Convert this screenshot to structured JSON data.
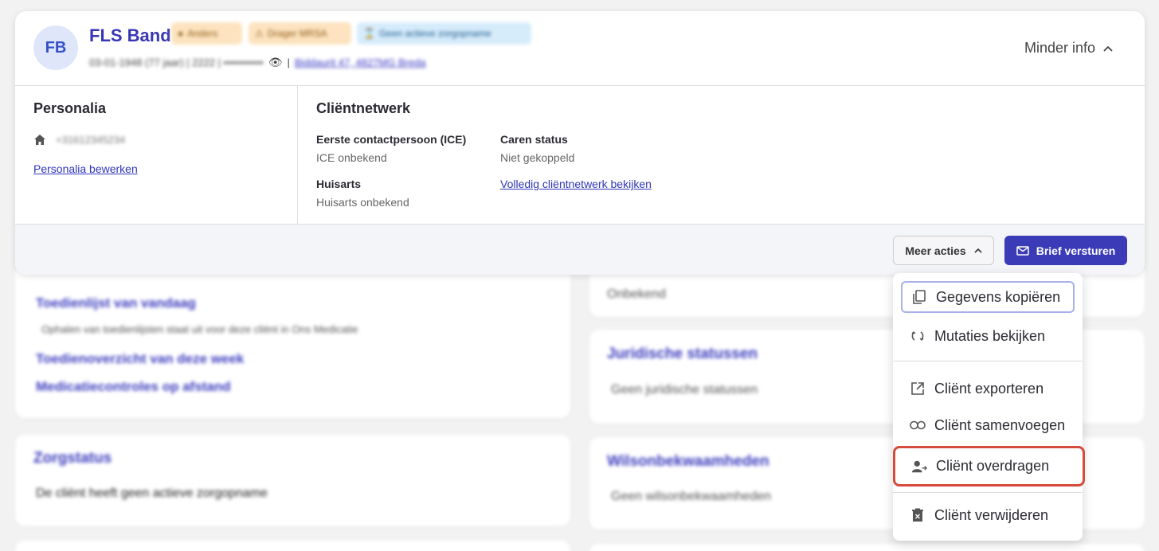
{
  "client": {
    "initials": "FB",
    "name": "FLS Band",
    "badges": [
      "Anders",
      "Drager MRSA",
      "Geen actieve zorgopname"
    ],
    "meta_line": "03-01-1948 (77 jaar) | 2222 | •••••••••••",
    "address": "Biddaurit 47, 4827MG Breda",
    "toggle_label": "Minder info"
  },
  "personalia": {
    "title": "Personalia",
    "phone": "+31612345234",
    "edit_link": "Personalia bewerken"
  },
  "netwerk": {
    "title": "Cliëntnetwerk",
    "ice_label": "Eerste contactpersoon (ICE)",
    "ice_value": "ICE onbekend",
    "caren_label": "Caren status",
    "caren_value": "Niet gekoppeld",
    "huisarts_label": "Huisarts",
    "huisarts_value": "Huisarts onbekend",
    "full_link": "Volledig cliëntnetwerk bekijken"
  },
  "actions": {
    "more_label": "Meer acties",
    "send_label": "Brief versturen"
  },
  "menu": {
    "items": [
      "Gegevens kopiëren",
      "Mutaties bekijken",
      "Cliënt exporteren",
      "Cliënt samenvoegen",
      "Cliënt overdragen",
      "Cliënt verwijderen"
    ]
  },
  "background": {
    "links": [
      "Toedienlijst van vandaag",
      "Toedienoverzicht van deze week",
      "Medicatiecontroles op afstand",
      "Zorgstatus",
      "Juridische statussen",
      "Wilsonbekwaamheden"
    ],
    "texts": [
      "Ophalen van toedienlijsten staat uit voor deze cliënt in Ons Medicatie",
      "De cliënt heeft geen actieve zorgopname",
      "Onbekend",
      "Geen juridische statussen",
      "Geen wilsonbekwaamheden"
    ]
  },
  "colors": {
    "brand": "#3b3bb8",
    "highlight": "#d64b3b"
  }
}
